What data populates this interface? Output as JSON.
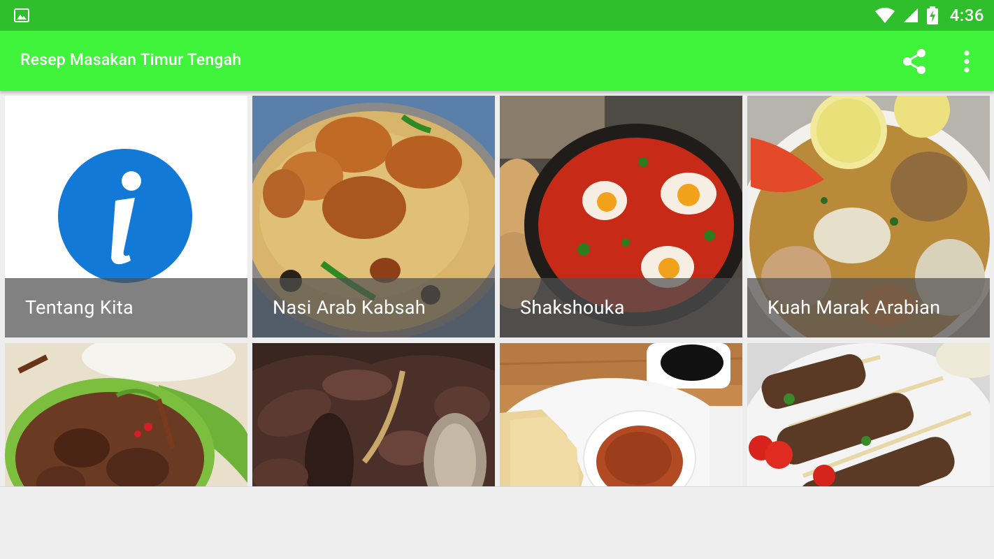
{
  "status_bar": {
    "time": "4:36",
    "icons": [
      "gallery-icon",
      "wifi-icon",
      "cell-signal-icon",
      "battery-charging-icon"
    ]
  },
  "app_bar": {
    "title": "Resep Masakan Timur Tengah",
    "actions": [
      "share-icon",
      "more-vert-icon"
    ]
  },
  "colors": {
    "status_bar": "#2fbf2c",
    "app_bar": "#3ff23a",
    "info_blue": "#1379d6",
    "caption_overlay": "rgba(80,80,80,0.72)"
  },
  "grid": {
    "items": [
      {
        "label": "Tentang Kita",
        "kind": "info-icon"
      },
      {
        "label": "Nasi Arab Kabsah",
        "kind": "photo"
      },
      {
        "label": "Shakshouka",
        "kind": "photo"
      },
      {
        "label": "Kuah Marak Arabian",
        "kind": "photo"
      },
      {
        "label": "",
        "kind": "photo"
      },
      {
        "label": "",
        "kind": "photo"
      },
      {
        "label": "",
        "kind": "photo"
      },
      {
        "label": "",
        "kind": "photo"
      }
    ]
  }
}
